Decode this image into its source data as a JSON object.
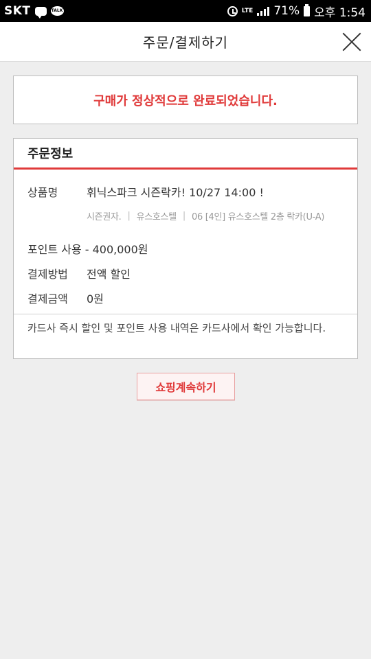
{
  "status_bar": {
    "carrier": "SKT",
    "battery_percent": "71%",
    "time": "오후 1:54",
    "network": "LTE",
    "icons": [
      "message-icon",
      "kakaotalk-icon",
      "alarm-icon",
      "lte-icon",
      "signal-icon",
      "battery-icon"
    ]
  },
  "header": {
    "title": "주문/결제하기",
    "close_icon": "close-icon"
  },
  "completion": {
    "message": "구매가 정상적으로 완료되었습니다."
  },
  "order": {
    "title": "주문정보",
    "product_label": "상품명",
    "product_name": "휘닉스파크 시즌락카! 10/27 14:00 !",
    "product_sub": [
      "시즌권자.",
      "유스호스텔",
      "06 [4인] 유스호스텔 2층 락카(U-A)"
    ],
    "points_text": "포인트 사용 - 400,000원",
    "payment_method_label": "결제방법",
    "payment_method_value": "전액 할인",
    "payment_amount_label": "결제금액",
    "payment_amount_value": "0원",
    "notice": "카드사 즉시 할인 및 포인트 사용 내역은 카드사에서 확인 가능합니다."
  },
  "actions": {
    "continue_shopping": "쇼핑계속하기"
  },
  "colors": {
    "accent": "#e03a3a",
    "background": "#eeeeee",
    "border": "#bdbdbd"
  }
}
